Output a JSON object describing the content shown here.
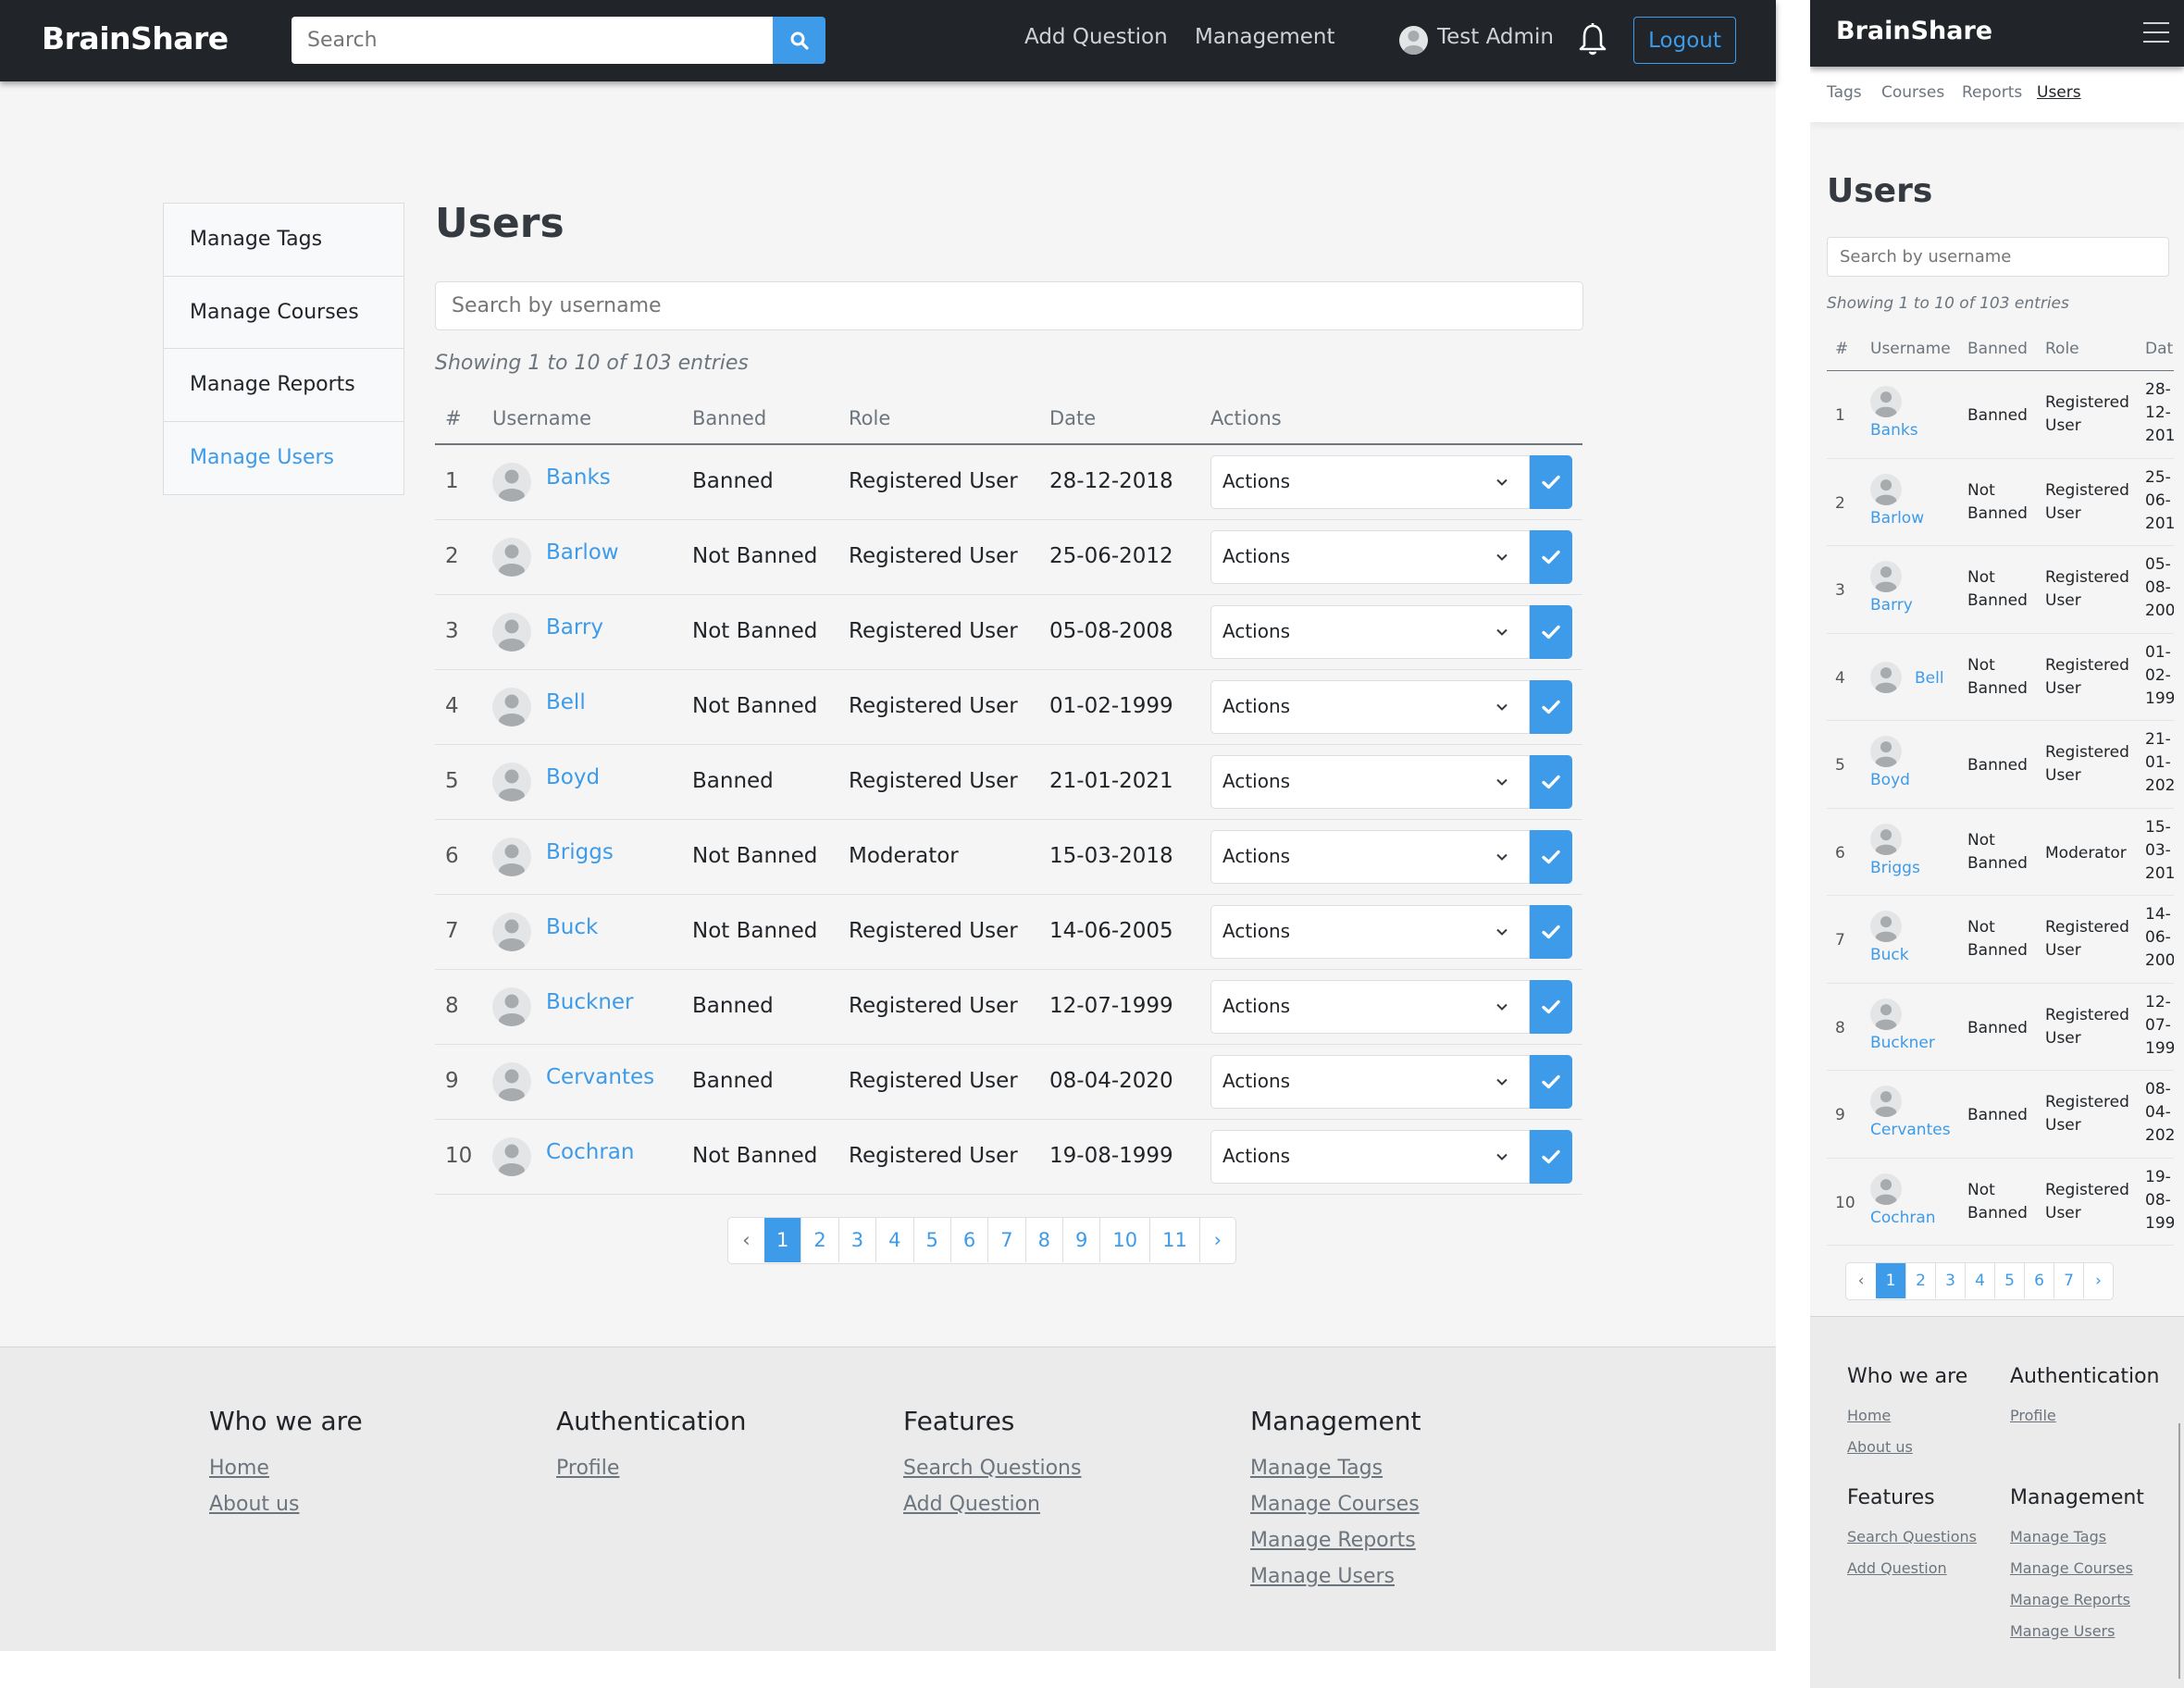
{
  "brand": "BrainShare",
  "colors": {
    "accent": "#3d9be9",
    "navbar": "#212529",
    "page_bg": "#f5f5f5",
    "footer_bg": "#ebebeb"
  },
  "header": {
    "search_placeholder": "Search",
    "search_icon": "search-icon",
    "nav": [
      "Add Question",
      "Management"
    ],
    "user_name": "Test Admin",
    "bell_icon": "bell-icon",
    "logout_label": "Logout"
  },
  "sidebar": {
    "items": [
      {
        "label": "Manage Tags",
        "active": false
      },
      {
        "label": "Manage Courses",
        "active": false
      },
      {
        "label": "Manage Reports",
        "active": false
      },
      {
        "label": "Manage Users",
        "active": true
      }
    ]
  },
  "main": {
    "title": "Users",
    "search_placeholder": "Search by username",
    "showing": "Showing 1 to 10 of 103 entries",
    "columns": [
      "#",
      "Username",
      "Banned",
      "Role",
      "Date",
      "Actions"
    ],
    "action_select_value": "Actions",
    "rows": [
      {
        "num": "1",
        "username": "Banks",
        "banned": "Banned",
        "role": "Registered User",
        "date": "28-12-2018"
      },
      {
        "num": "2",
        "username": "Barlow",
        "banned": "Not Banned",
        "role": "Registered User",
        "date": "25-06-2012"
      },
      {
        "num": "3",
        "username": "Barry",
        "banned": "Not Banned",
        "role": "Registered User",
        "date": "05-08-2008"
      },
      {
        "num": "4",
        "username": "Bell",
        "banned": "Not Banned",
        "role": "Registered User",
        "date": "01-02-1999"
      },
      {
        "num": "5",
        "username": "Boyd",
        "banned": "Banned",
        "role": "Registered User",
        "date": "21-01-2021"
      },
      {
        "num": "6",
        "username": "Briggs",
        "banned": "Not Banned",
        "role": "Moderator",
        "date": "15-03-2018"
      },
      {
        "num": "7",
        "username": "Buck",
        "banned": "Not Banned",
        "role": "Registered User",
        "date": "14-06-2005"
      },
      {
        "num": "8",
        "username": "Buckner",
        "banned": "Banned",
        "role": "Registered User",
        "date": "12-07-1999"
      },
      {
        "num": "9",
        "username": "Cervantes",
        "banned": "Banned",
        "role": "Registered User",
        "date": "08-04-2020"
      },
      {
        "num": "10",
        "username": "Cochran",
        "banned": "Not Banned",
        "role": "Registered User",
        "date": "19-08-1999"
      }
    ],
    "pagination": {
      "prev": "‹",
      "next": "›",
      "pages": [
        "1",
        "2",
        "3",
        "4",
        "5",
        "6",
        "7",
        "8",
        "9",
        "10",
        "11"
      ],
      "current": "1"
    }
  },
  "footer": {
    "columns": [
      {
        "title": "Who we are",
        "links": [
          "Home",
          "About us"
        ]
      },
      {
        "title": "Authentication",
        "links": [
          "Profile"
        ]
      },
      {
        "title": "Features",
        "links": [
          "Search Questions",
          "Add Question"
        ]
      },
      {
        "title": "Management",
        "links": [
          "Manage Tags",
          "Manage Courses",
          "Manage Reports",
          "Manage Users"
        ]
      }
    ]
  },
  "mobile": {
    "menu_icon": "hamburger-icon",
    "subnav": [
      {
        "label": "Tags",
        "active": false
      },
      {
        "label": "Courses",
        "active": false
      },
      {
        "label": "Reports",
        "active": false
      },
      {
        "label": "Users",
        "active": true
      }
    ],
    "columns_visible": [
      "#",
      "Username",
      "Banned",
      "Role",
      "Dat"
    ],
    "rows": [
      {
        "banned_lines": [
          "Banned"
        ],
        "role_lines": [
          "Registered",
          "User"
        ],
        "date_lines": [
          "28-",
          "12-",
          "201"
        ]
      },
      {
        "banned_lines": [
          "Not",
          "Banned"
        ],
        "role_lines": [
          "Registered",
          "User"
        ],
        "date_lines": [
          "25-",
          "06-",
          "201"
        ]
      },
      {
        "banned_lines": [
          "Not",
          "Banned"
        ],
        "role_lines": [
          "Registered",
          "User"
        ],
        "date_lines": [
          "05-",
          "08-",
          "200"
        ]
      },
      {
        "banned_lines": [
          "Not",
          "Banned"
        ],
        "role_lines": [
          "Registered",
          "User"
        ],
        "date_lines": [
          "01-",
          "02-",
          "199"
        ]
      },
      {
        "banned_lines": [
          "Banned"
        ],
        "role_lines": [
          "Registered",
          "User"
        ],
        "date_lines": [
          "21-",
          "01-",
          "202"
        ]
      },
      {
        "banned_lines": [
          "Not",
          "Banned"
        ],
        "role_lines": [
          "Moderator"
        ],
        "date_lines": [
          "15-",
          "03-",
          "201"
        ]
      },
      {
        "banned_lines": [
          "Not",
          "Banned"
        ],
        "role_lines": [
          "Registered",
          "User"
        ],
        "date_lines": [
          "14-",
          "06-",
          "200"
        ]
      },
      {
        "banned_lines": [
          "Banned"
        ],
        "role_lines": [
          "Registered",
          "User"
        ],
        "date_lines": [
          "12-",
          "07-",
          "199"
        ]
      },
      {
        "banned_lines": [
          "Banned"
        ],
        "role_lines": [
          "Registered",
          "User"
        ],
        "date_lines": [
          "08-",
          "04-",
          "202"
        ]
      },
      {
        "banned_lines": [
          "Not",
          "Banned"
        ],
        "role_lines": [
          "Registered",
          "User"
        ],
        "date_lines": [
          "19-",
          "08-",
          "199"
        ]
      }
    ],
    "pagination": {
      "prev": "‹",
      "next": "›",
      "pages": [
        "1",
        "2",
        "3",
        "4",
        "5",
        "6",
        "7"
      ],
      "current": "1"
    }
  }
}
